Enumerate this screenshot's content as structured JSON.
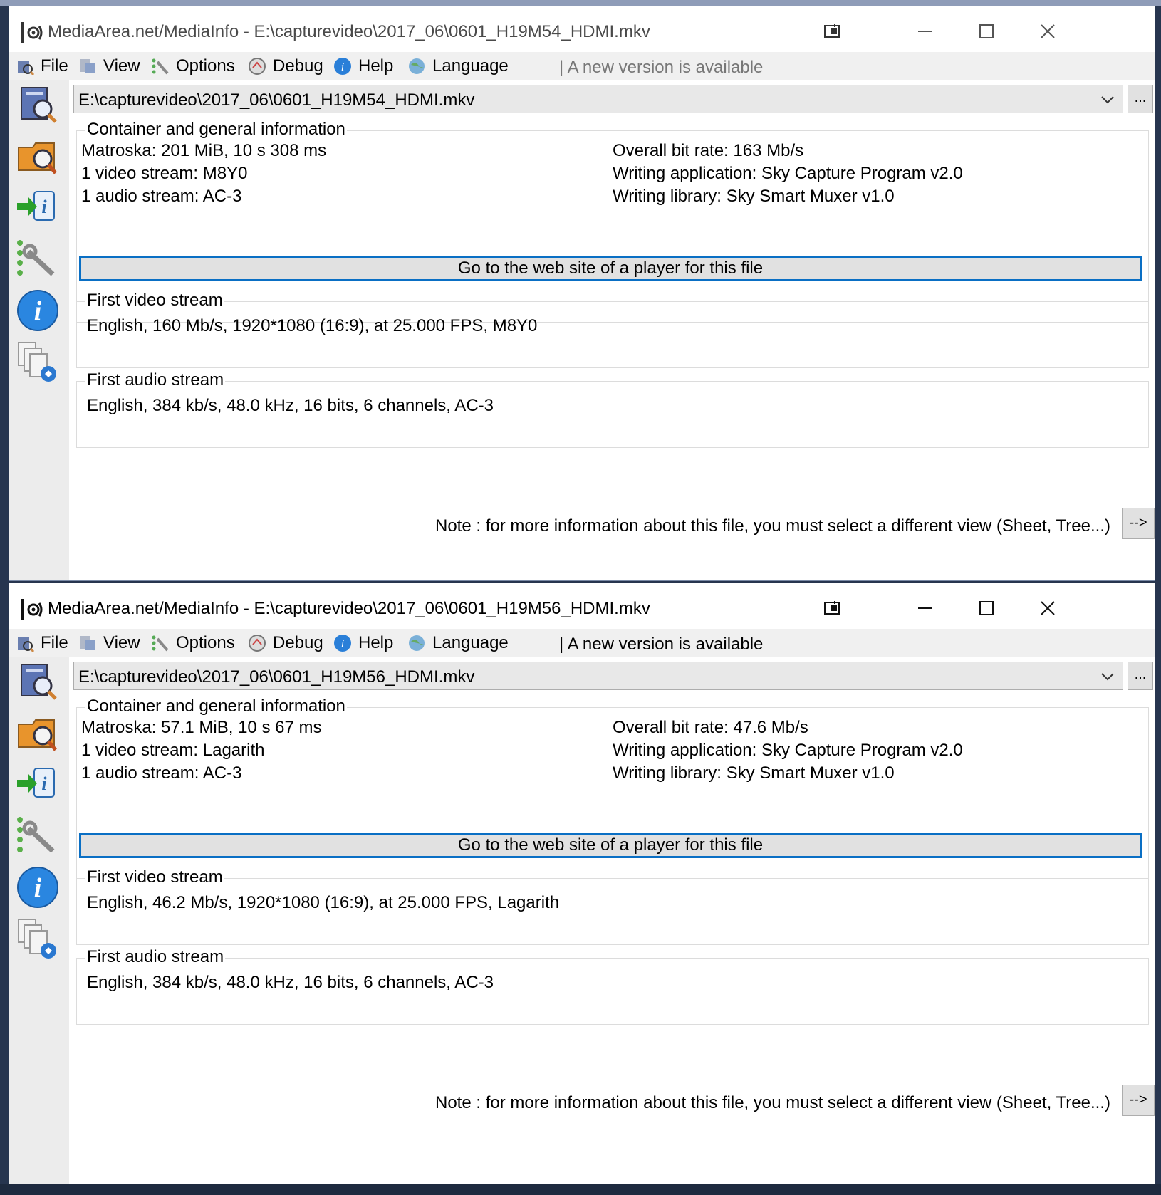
{
  "windows": [
    {
      "title": "MediaArea.net/MediaInfo - E:\\capturevideo\\2017_06\\0601_H19M54_HDMI.mkv",
      "menu": {
        "file": "File",
        "view": "View",
        "options": "Options",
        "debug": "Debug",
        "help": "Help",
        "language": "Language"
      },
      "new_version": "| A new version is available",
      "file_path": "E:\\capturevideo\\2017_06\\0601_H19M54_HDMI.mkv",
      "browse_label": "...",
      "general": {
        "legend": "Container and general information",
        "left": [
          "Matroska: 201 MiB, 10 s 308 ms",
          "1 video stream: M8Y0",
          "1 audio stream: AC-3"
        ],
        "right": [
          "Overall bit rate: 163 Mb/s",
          "Writing application: Sky Capture Program v2.0",
          "Writing library: Sky Smart Muxer v1.0"
        ]
      },
      "web_button": "Go to the web site of a player for this file",
      "video": {
        "legend": "First video stream",
        "text": "English, 160 Mb/s, 1920*1080 (16:9), at 25.000 FPS, M8Y0"
      },
      "audio": {
        "legend": "First audio stream",
        "text": "English, 384 kb/s, 48.0 kHz, 16 bits, 6 channels, AC-3"
      },
      "note": "Note : for more information about this file, you must select a different view (Sheet, Tree...)",
      "arrow_button": "-->"
    },
    {
      "title": "MediaArea.net/MediaInfo - E:\\capturevideo\\2017_06\\0601_H19M56_HDMI.mkv",
      "menu": {
        "file": "File",
        "view": "View",
        "options": "Options",
        "debug": "Debug",
        "help": "Help",
        "language": "Language"
      },
      "new_version": "| A new version is available",
      "file_path": "E:\\capturevideo\\2017_06\\0601_H19M56_HDMI.mkv",
      "browse_label": "...",
      "general": {
        "legend": "Container and general information",
        "left": [
          "Matroska: 57.1 MiB, 10 s 67 ms",
          "1 video stream: Lagarith",
          "1 audio stream: AC-3"
        ],
        "right": [
          "Overall bit rate: 47.6 Mb/s",
          "Writing application: Sky Capture Program v2.0",
          "Writing library: Sky Smart Muxer v1.0"
        ]
      },
      "web_button": "Go to the web site of a player for this file",
      "video": {
        "legend": "First video stream",
        "text": "English, 46.2 Mb/s, 1920*1080 (16:9), at 25.000 FPS, Lagarith"
      },
      "audio": {
        "legend": "First audio stream",
        "text": "English, 384 kb/s, 48.0 kHz, 16 bits, 6 channels, AC-3"
      },
      "note": "Note : for more information about this file, you must select a different view (Sheet, Tree...)",
      "arrow_button": "-->"
    }
  ],
  "icons": [
    "app-logo-icon",
    "tablet-mode-icon",
    "minimize-icon",
    "maximize-icon",
    "close-icon",
    "file-open-icon",
    "view-icon",
    "options-icon",
    "debug-icon",
    "help-icon",
    "language-icon",
    "open-file-icon",
    "open-folder-icon",
    "export-icon",
    "preferences-icon",
    "about-icon",
    "knowledge-base-icon",
    "dropdown-chevron-icon"
  ]
}
